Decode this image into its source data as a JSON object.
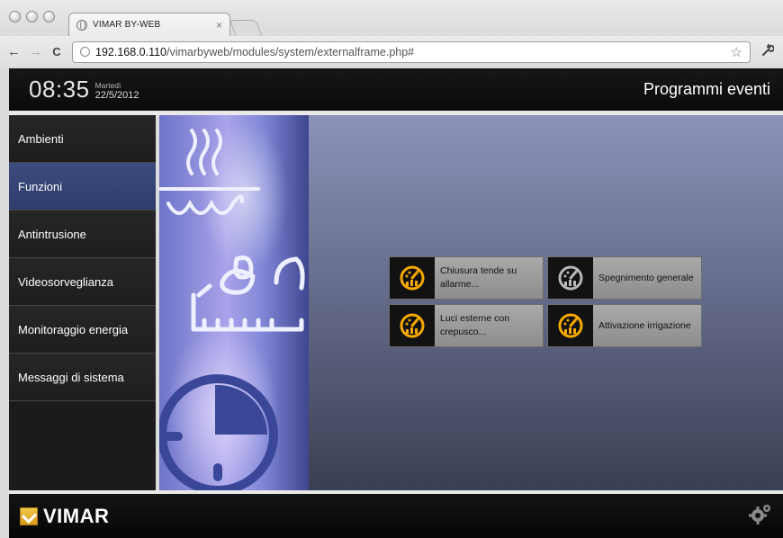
{
  "browser": {
    "tab_title": "VIMAR BY-WEB",
    "tab_close": "×",
    "url_host": "192.168.0.110",
    "url_path": "/vimarbyweb/modules/system/externalframe.php#",
    "back": "←",
    "forward": "→",
    "reload": "C",
    "star": "☆",
    "wrench": "🔧"
  },
  "header": {
    "time": "08:35",
    "day": "Martedì",
    "date": "22/5/2012",
    "title": "Programmi eventi"
  },
  "sidebar": {
    "items": [
      {
        "label": "Ambienti",
        "active": false
      },
      {
        "label": "Funzioni",
        "active": true
      },
      {
        "label": "Antintrusione",
        "active": false
      },
      {
        "label": "Videosorveglianza",
        "active": false
      },
      {
        "label": "Monitoraggio energia",
        "active": false
      },
      {
        "label": "Messaggi di sistema",
        "active": false
      }
    ]
  },
  "programs": [
    {
      "label": "Chiusura tende su allarme...",
      "icon": "event-program-icon-active",
      "color": "#f5a800"
    },
    {
      "label": "Spegnimento generale",
      "icon": "event-program-icon-inactive",
      "color": "#b8b8b8"
    },
    {
      "label": "Luci esterne con crepusco...",
      "icon": "event-program-icon-active",
      "color": "#f5a800"
    },
    {
      "label": "Attivazione irrigazione",
      "icon": "event-program-icon-active",
      "color": "#f5a800"
    }
  ],
  "footer": {
    "brand": "VIMAR",
    "settings_icon": "gears-icon"
  },
  "colors": {
    "active_nav": "#34417a",
    "accent": "#f5a800"
  }
}
